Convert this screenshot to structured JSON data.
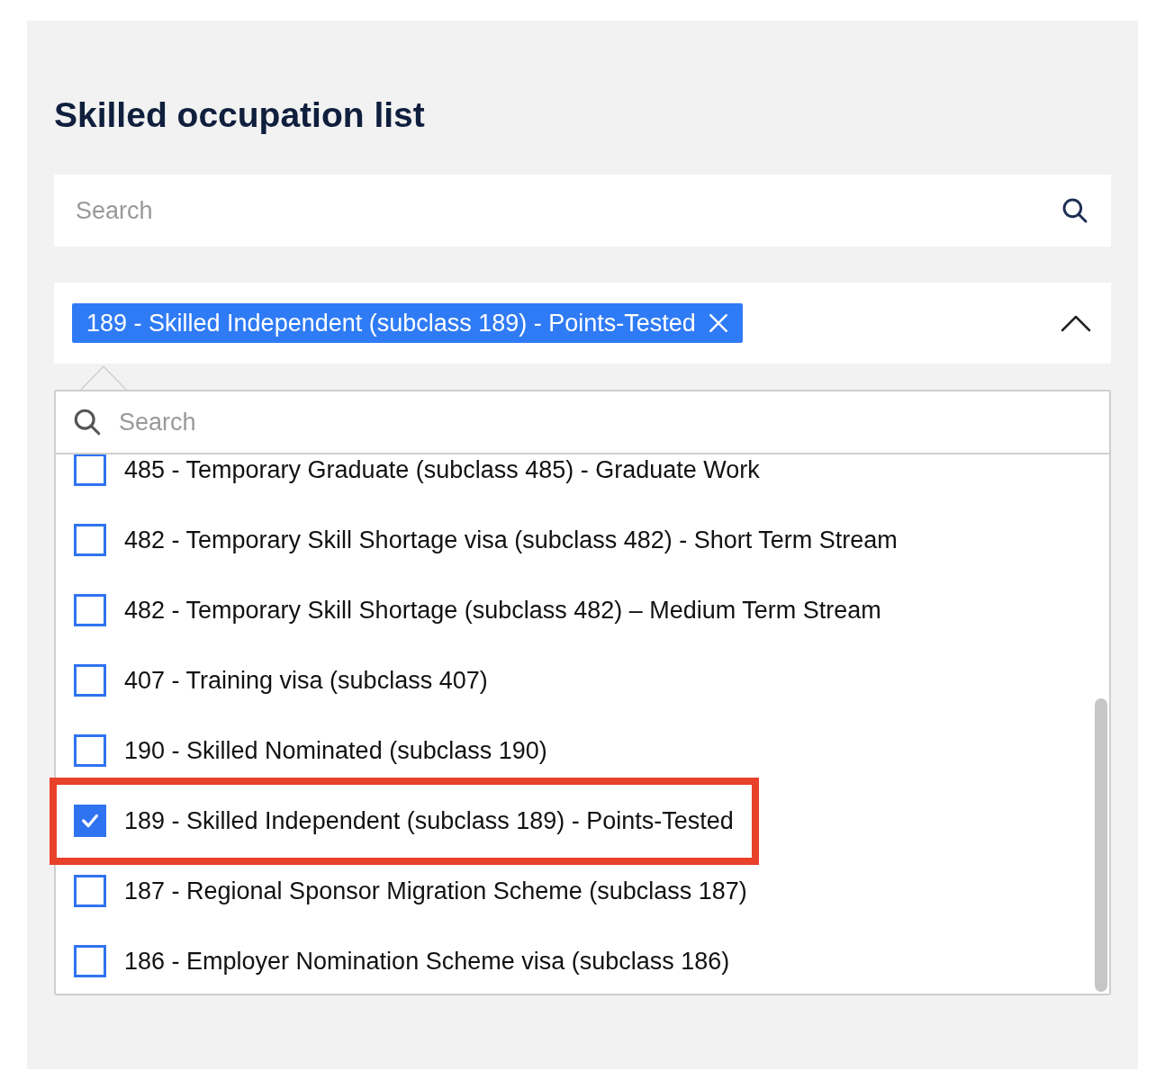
{
  "title": "Skilled occupation list",
  "search": {
    "placeholder": "Search"
  },
  "multiselect": {
    "expanded": true,
    "chips": [
      {
        "label": "189 - Skilled Independent (subclass 189) - Points-Tested"
      }
    ],
    "dropdown": {
      "search_placeholder": "Search",
      "options": [
        {
          "label": "485 - Temporary Graduate (subclass 485) - Graduate Work",
          "checked": false,
          "highlighted": false
        },
        {
          "label": "482 - Temporary Skill Shortage visa (subclass 482) - Short Term Stream",
          "checked": false,
          "highlighted": false
        },
        {
          "label": "482 - Temporary Skill Shortage (subclass 482) – Medium Term Stream",
          "checked": false,
          "highlighted": false
        },
        {
          "label": "407 - Training visa (subclass 407)",
          "checked": false,
          "highlighted": false
        },
        {
          "label": "190 - Skilled Nominated (subclass 190)",
          "checked": false,
          "highlighted": false
        },
        {
          "label": "189 - Skilled Independent (subclass 189) - Points-Tested",
          "checked": true,
          "highlighted": true
        },
        {
          "label": "187 - Regional Sponsor Migration Scheme (subclass 187)",
          "checked": false,
          "highlighted": false
        },
        {
          "label": "186 - Employer Nomination Scheme visa (subclass 186)",
          "checked": false,
          "highlighted": false
        }
      ]
    }
  }
}
